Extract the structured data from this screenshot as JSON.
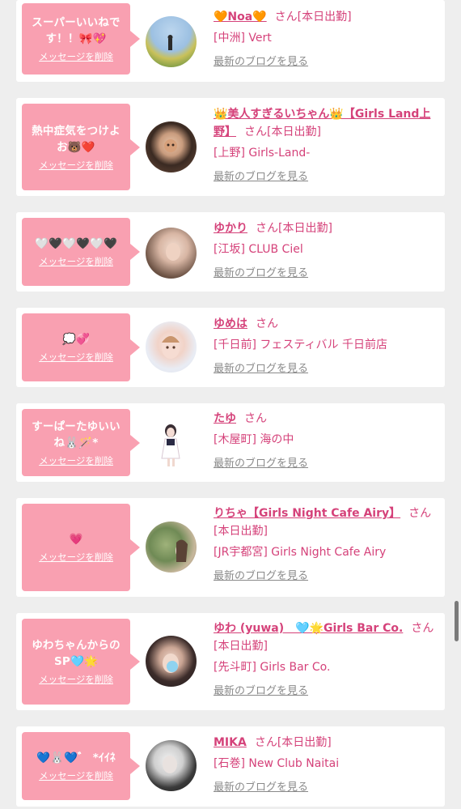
{
  "delete_label": "メッセージを削除",
  "blog_label": "最新のブログを見る",
  "san_label": "さん",
  "working_label": "[本日出勤]",
  "items": [
    {
      "message": "スーパーいいねです！！🎀💖",
      "name": "🧡Noa🧡",
      "working": true,
      "shop": "[中洲] Vert"
    },
    {
      "message": "熱中症気をつけよお🐻❤️",
      "name": "👑美人すぎるいちゃん👑【Girls Land上野】",
      "working": true,
      "shop": "[上野] Girls-Land-"
    },
    {
      "message": "🤍🖤🤍🖤🤍🖤",
      "name": "ゆかり",
      "working": true,
      "shop": "[江坂] CLUB Ciel"
    },
    {
      "message": "💭💞",
      "name": "ゆめは",
      "working": false,
      "shop": "[千日前] フェスティバル 千日前店"
    },
    {
      "message": "すーぱーたゆいいね🐰🪄*",
      "name": "たゆ",
      "working": false,
      "shop": "[木屋町] 海の中"
    },
    {
      "message": "💗",
      "name": "りちゃ【Girls Night Cafe Airy】",
      "working": true,
      "shop": "[JR宇都宮] Girls Night Cafe Airy"
    },
    {
      "message": "ゆわちゃんからのSP🩵🌟",
      "name": "ゆわ (yuwa)　🩵🌟Girls Bar Co.",
      "working": true,
      "shop": "[先斗町] Girls Bar Co."
    },
    {
      "message": "💙🐰💙゛ *ｲｲﾈ",
      "name": "MIKA",
      "working": true,
      "shop": "[石巻] New Club Naitai"
    }
  ],
  "colors": {
    "accent": "#d5427a",
    "bubble": "#f9a0b1",
    "background": "#eeeeee",
    "blog_link": "#8a8a8a"
  }
}
